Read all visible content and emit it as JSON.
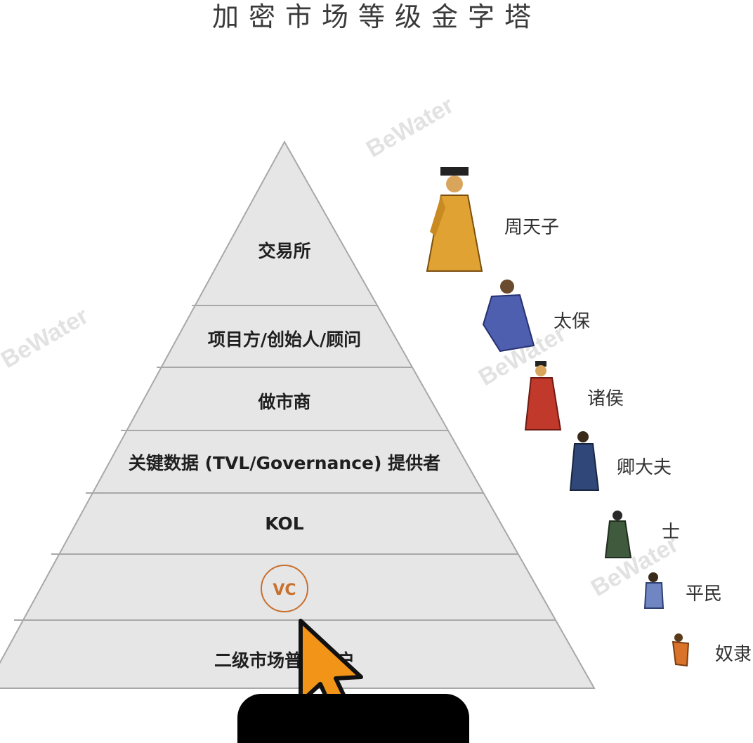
{
  "title": "加密市场等级金字塔",
  "watermark": "BeWater",
  "pyramid": {
    "tiers": [
      {
        "label": "交易所"
      },
      {
        "label": "项目方/创始人/顾问"
      },
      {
        "label": "做市商"
      },
      {
        "label": "关键数据 (TVL/Governance) 提供者"
      },
      {
        "label": "KOL"
      },
      {
        "label": "VC"
      },
      {
        "label": "二级市场普通用户"
      }
    ],
    "highlight_color": "#c8702e",
    "fill": "#e6e6e6",
    "stroke": "#a8a8a8"
  },
  "ranks": [
    {
      "label": "周天子",
      "icon": "emperor-figure-icon",
      "color": "#e0a232"
    },
    {
      "label": "太保",
      "icon": "grand-protector-figure-icon",
      "color": "#4e5fb0"
    },
    {
      "label": "诸侯",
      "icon": "feudal-lord-figure-icon",
      "color": "#c0392b"
    },
    {
      "label": "卿大夫",
      "icon": "minister-figure-icon",
      "color": "#2f4779"
    },
    {
      "label": "士",
      "icon": "scholar-figure-icon",
      "color": "#3f5a3c"
    },
    {
      "label": "平民",
      "icon": "commoner-figure-icon",
      "color": "#6f86c2"
    },
    {
      "label": "奴隶",
      "icon": "slave-figure-icon",
      "color": "#d9732a"
    }
  ],
  "cursor_color": "#f29418"
}
